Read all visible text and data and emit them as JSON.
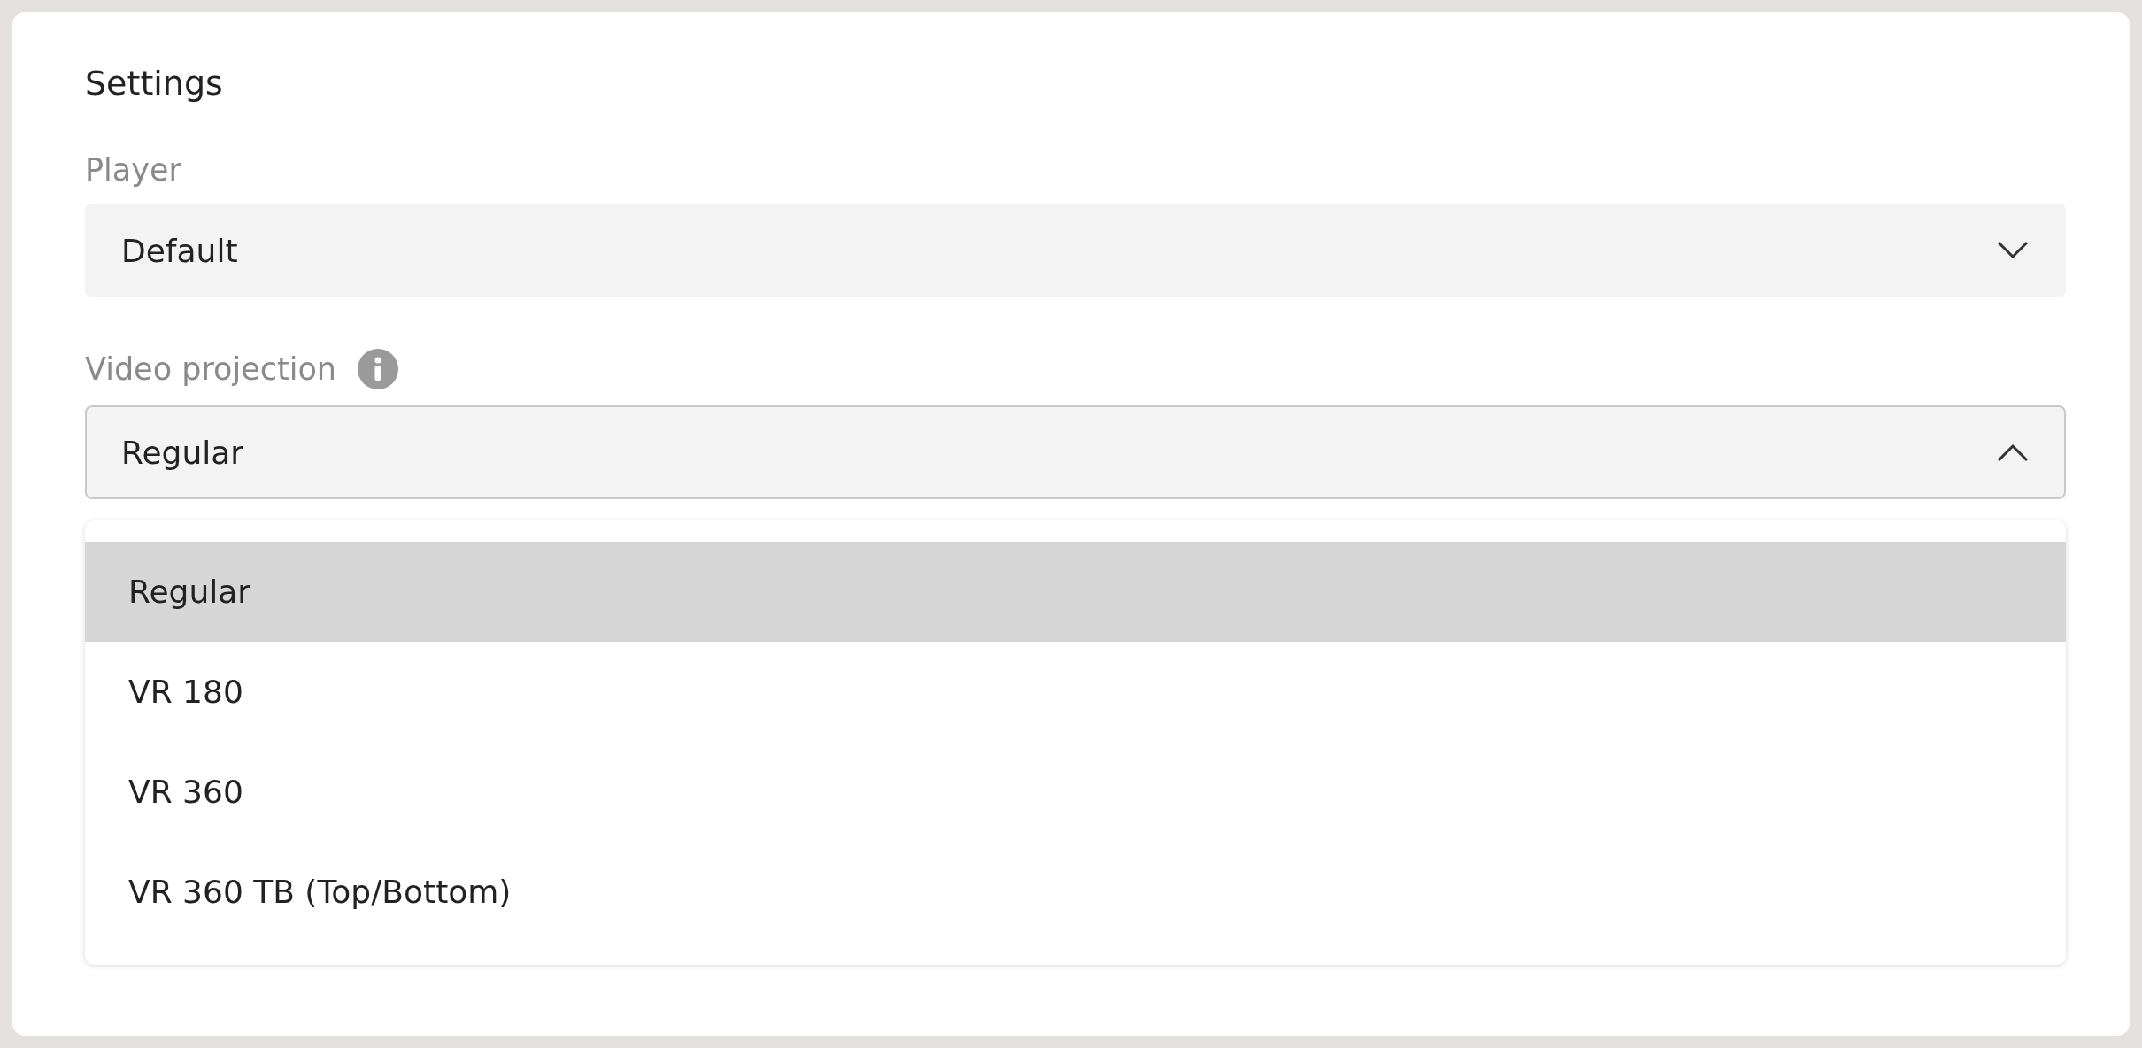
{
  "title": "Settings",
  "fields": [
    {
      "label": "Player",
      "value": "Default",
      "info": false,
      "expanded": false
    },
    {
      "label": "Video projection",
      "value": "Regular",
      "info": true,
      "expanded": true
    }
  ],
  "options": [
    {
      "label": "Regular",
      "selected": true
    },
    {
      "label": "VR 180",
      "selected": false
    },
    {
      "label": "VR 360",
      "selected": false
    },
    {
      "label": "VR 360 TB (Top/Bottom)",
      "selected": false
    }
  ]
}
